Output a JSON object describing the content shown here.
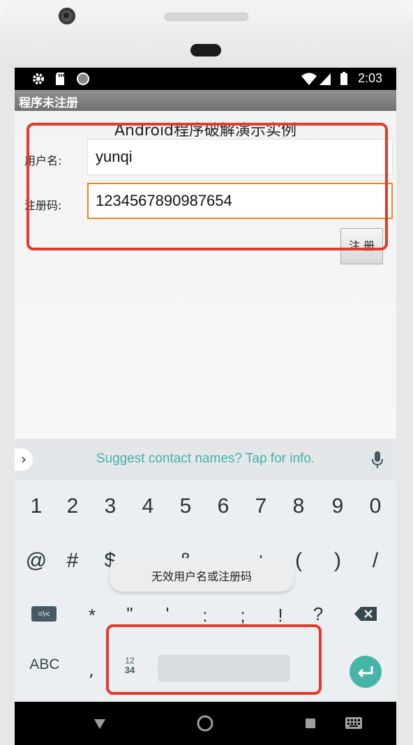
{
  "status_bar": {
    "time": "2:03",
    "icons": [
      "settings-gear-icon",
      "sd-card-icon",
      "circle-icon",
      "wifi-icon",
      "signal-icon",
      "battery-icon"
    ]
  },
  "app": {
    "title": "程序未注册",
    "heading": "Android程序破解演示实例",
    "username_label": "用户名:",
    "username_value": "yunqi",
    "code_label": "注册码:",
    "code_value": "1234567890987654",
    "register_button": "注 册"
  },
  "keyboard": {
    "suggestion": "Suggest contact names? Tap for info.",
    "number_row": [
      "1",
      "2",
      "3",
      "4",
      "5",
      "6",
      "7",
      "8",
      "9",
      "0"
    ],
    "symbol_row": [
      "@",
      "#",
      "$",
      "_",
      "&",
      "-",
      "+",
      "(",
      ")",
      "/"
    ],
    "third_row": [
      "=\\<",
      "*",
      "\"",
      "'",
      ":",
      ";",
      "!",
      "?"
    ],
    "abc_label": "ABC",
    "comma": ",",
    "numpad_label_top": "12",
    "numpad_label_bottom": "34"
  },
  "toast": {
    "message": "无效用户名或注册码"
  },
  "colors": {
    "highlight": "#e43a2c",
    "focus_border": "#e8861c",
    "accent": "#46b5a5"
  }
}
